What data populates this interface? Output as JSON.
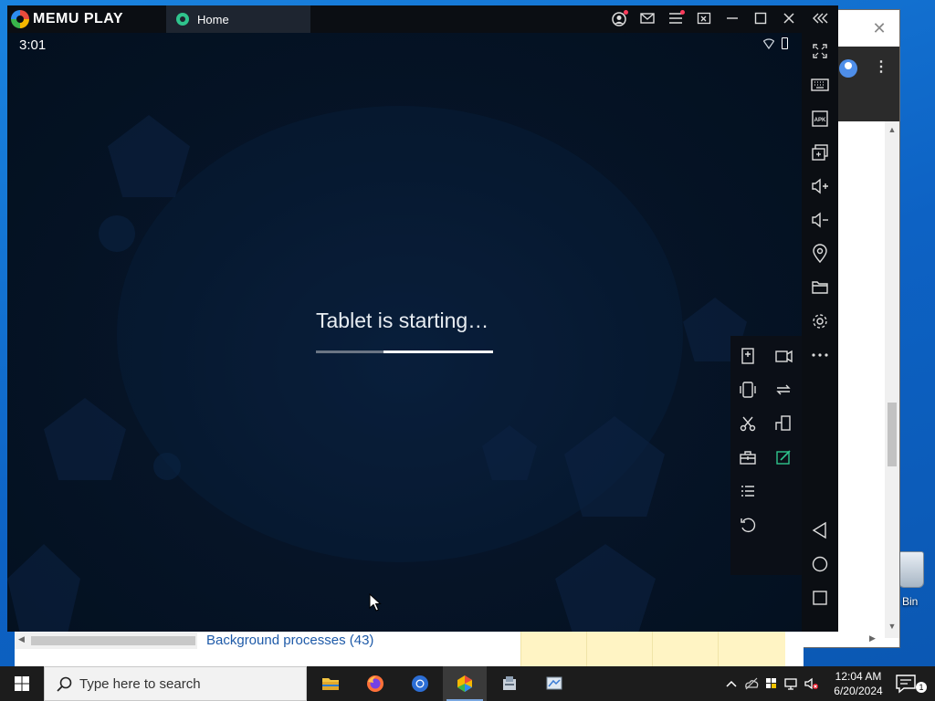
{
  "memu": {
    "brand": "MEMU PLAY",
    "tab_label": "Home",
    "titlebar_buttons": [
      "account-icon",
      "mail-icon",
      "menu-icon",
      "multi-window-icon",
      "minimize-icon",
      "maximize-icon",
      "close-icon",
      "collapse-sidebar-icon"
    ]
  },
  "android": {
    "time": "3:01",
    "starting_text": "Tablet is starting…",
    "progress": 0.38
  },
  "tool_panel": [
    "install-apk-icon",
    "record-icon",
    "shake-icon",
    "sync-icon",
    "screenshot-icon",
    "rotate-icon",
    "toolbox-icon",
    "edit-icon",
    "list-icon",
    "refresh-icon"
  ],
  "sidebar": [
    "fullscreen-icon",
    "keyboard-icon",
    "apk-icon",
    "multi-instance-icon",
    "volume-up-icon",
    "volume-down-icon",
    "location-icon",
    "folder-icon",
    "settings-icon",
    "more-icon",
    "back-icon",
    "home-icon",
    "recents-icon"
  ],
  "taskmgr": {
    "section_label": "Background processes (43)"
  },
  "desktop": {
    "recycle_bin_label": "Bin"
  },
  "taskbar": {
    "search_placeholder": "Type here to search",
    "apps": [
      "file-explorer-icon",
      "firefox-icon",
      "chrome-icon",
      "memu-icon",
      "app-installer-icon",
      "paint-icon"
    ],
    "time": "12:04 AM",
    "date": "6/20/2024",
    "notification_count": "1"
  },
  "colors": {
    "memu_bg": "#0b0e13",
    "screen_bg": "#061427",
    "accent_green": "#2fc48d",
    "desktop_blue": "#0d62c4"
  }
}
